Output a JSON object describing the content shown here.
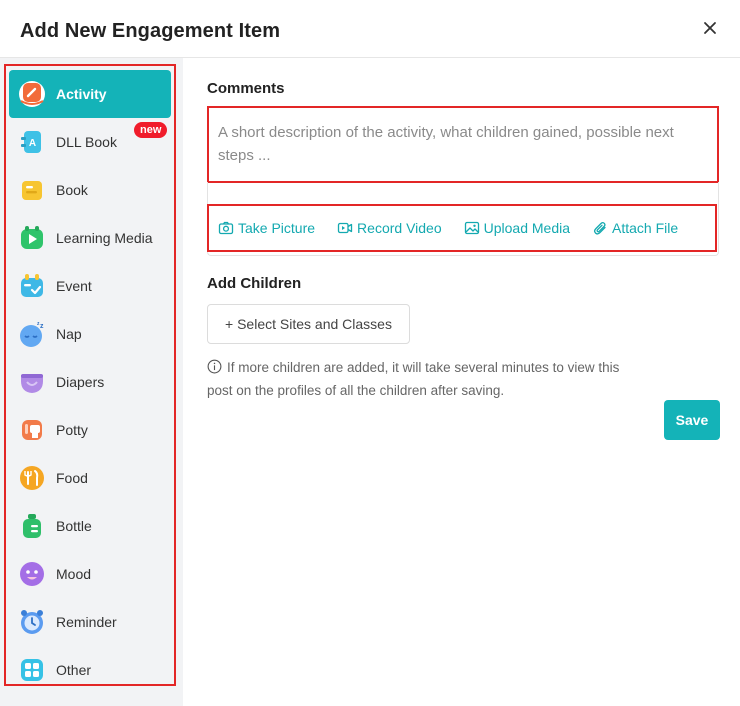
{
  "dialog": {
    "title": "Add New Engagement Item",
    "close_icon": "close-icon"
  },
  "sidebar": {
    "items": [
      {
        "label": "Activity",
        "icon": "activity-icon",
        "color": "#f26b3a",
        "active": true
      },
      {
        "label": "DLL Book",
        "icon": "dll-book-icon",
        "color": "#3fc1e6",
        "badge": "new"
      },
      {
        "label": "Book",
        "icon": "book-icon",
        "color": "#f7c531"
      },
      {
        "label": "Learning Media",
        "icon": "learning-media-icon",
        "color": "#2fc46b"
      },
      {
        "label": "Event",
        "icon": "event-icon",
        "color": "#3fb8e6"
      },
      {
        "label": "Nap",
        "icon": "nap-icon",
        "color": "#62a8f2"
      },
      {
        "label": "Diapers",
        "icon": "diapers-icon",
        "color": "#b18ae6"
      },
      {
        "label": "Potty",
        "icon": "potty-icon",
        "color": "#f27b4a"
      },
      {
        "label": "Food",
        "icon": "food-icon",
        "color": "#f5a623"
      },
      {
        "label": "Bottle",
        "icon": "bottle-icon",
        "color": "#2fbf6a"
      },
      {
        "label": "Mood",
        "icon": "mood-icon",
        "color": "#a46ee6"
      },
      {
        "label": "Reminder",
        "icon": "reminder-icon",
        "color": "#5b9bf0"
      },
      {
        "label": "Other",
        "icon": "other-icon",
        "color": "#36c2e6"
      }
    ]
  },
  "comments": {
    "label": "Comments",
    "placeholder": "A short description of the activity, what children gained, possible next steps ..."
  },
  "attachments": {
    "take_picture": "Take Picture",
    "record_video": "Record Video",
    "upload_media": "Upload Media",
    "attach_file": "Attach File"
  },
  "children": {
    "label": "Add Children",
    "button": "+ Select Sites and Classes",
    "notice": "If more children are added, it will take several minutes to view this post on the profiles of all the children after saving."
  },
  "actions": {
    "save": "Save"
  },
  "colors": {
    "accent": "#14b3b8",
    "link": "#14a9b0",
    "highlight_outline": "#e32626",
    "badge": "#f01c2b"
  }
}
